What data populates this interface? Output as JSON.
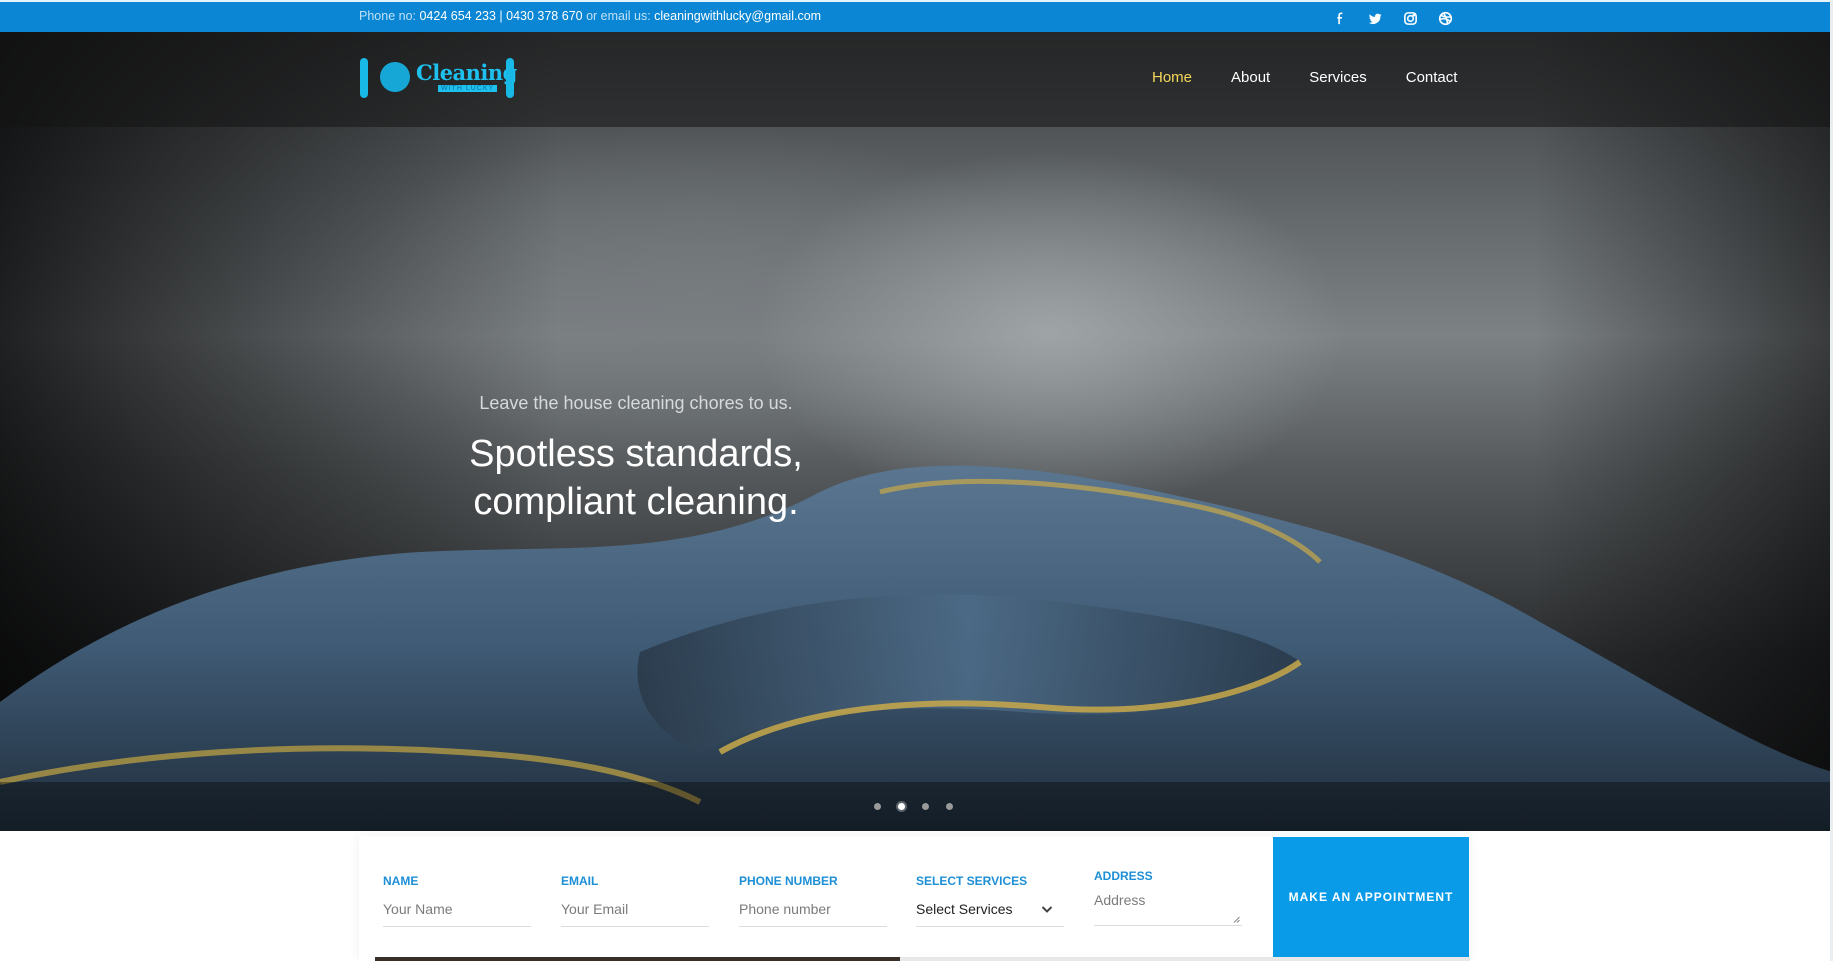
{
  "topbar": {
    "phone_label": "Phone no: ",
    "phone_value": "0424 654 233 | 0430 378 670",
    "email_label": " or email us: ",
    "email_value": "cleaningwithlucky@gmail.com",
    "social_icons": [
      "facebook-icon",
      "twitter-icon",
      "instagram-icon",
      "dribbble-icon"
    ]
  },
  "logo": {
    "word": "Cleaning",
    "sub": "WITH LUCKY"
  },
  "nav": {
    "items": [
      {
        "label": "Home",
        "active": true
      },
      {
        "label": "About",
        "active": false
      },
      {
        "label": "Services",
        "active": false
      },
      {
        "label": "Contact",
        "active": false
      }
    ]
  },
  "hero": {
    "kicker": "Leave the house cleaning chores to us.",
    "headline_line1": "Spotless standards,",
    "headline_line2": "compliant cleaning.",
    "slides_total": 4,
    "active_slide": 2
  },
  "form": {
    "name": {
      "label": "NAME",
      "placeholder": "Your Name"
    },
    "email": {
      "label": "EMAIL",
      "placeholder": "Your Email"
    },
    "phone": {
      "label": "PHONE NUMBER",
      "placeholder": "Phone number"
    },
    "services": {
      "label": "SELECT SERVICES",
      "selected": "Select Services"
    },
    "address": {
      "label": "ADDRESS",
      "placeholder": "Address"
    },
    "submit_label": "MAKE AN APPOINTMENT"
  },
  "colors": {
    "topbar": "#0a86d4",
    "accent_nav": "#f5d75a",
    "button": "#0a9be8",
    "label": "#1d8fd6"
  }
}
